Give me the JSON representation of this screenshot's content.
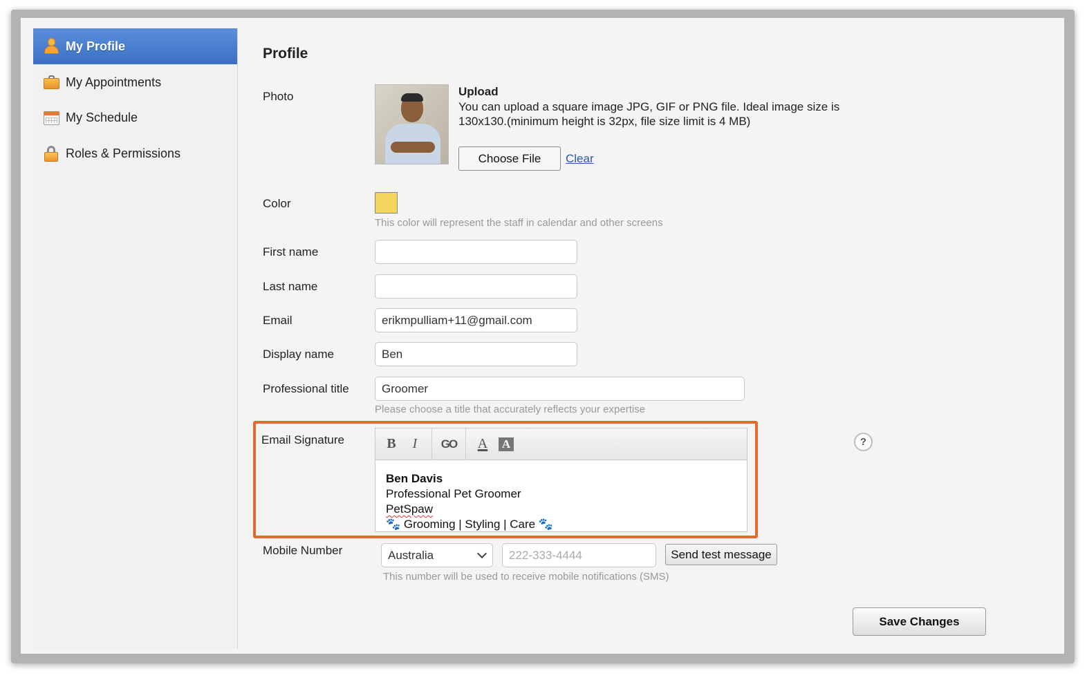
{
  "colors": {
    "sidebar_active": "#4a7fd2",
    "staff_color": "#f6d55c",
    "highlight_border": "#e3692f",
    "link": "#2a55b5"
  },
  "sidebar": {
    "items": [
      {
        "label": "My Profile",
        "icon": "user-icon",
        "active": true
      },
      {
        "label": "My Appointments",
        "icon": "briefcase-icon",
        "active": false
      },
      {
        "label": "My Schedule",
        "icon": "calendar-icon",
        "active": false
      },
      {
        "label": "Roles & Permissions",
        "icon": "lock-icon",
        "active": false
      }
    ]
  },
  "main": {
    "title": "Profile",
    "photo": {
      "label": "Photo",
      "upload_title": "Upload",
      "upload_description": "You can upload a square image JPG, GIF or PNG file. Ideal image size is 130x130.(minimum height is 32px, file size limit is 4 MB)",
      "choose_file_label": "Choose File",
      "clear_label": "Clear"
    },
    "color": {
      "label": "Color",
      "hint": "This color will represent the staff in calendar and other screens"
    },
    "first_name": {
      "label": "First name",
      "value": ""
    },
    "last_name": {
      "label": "Last name",
      "value": ""
    },
    "email": {
      "label": "Email",
      "value": "erikmpulliam+11@gmail.com"
    },
    "display_name": {
      "label": "Display name",
      "value": "Ben"
    },
    "professional_title": {
      "label": "Professional title",
      "value": "Groomer",
      "hint": "Please choose a title that accurately reflects your expertise"
    },
    "email_signature": {
      "label": "Email Signature",
      "toolbar": {
        "bold": "B",
        "italic": "I",
        "link": "GO",
        "font_color": "A",
        "bg_color": "A"
      },
      "lines": {
        "name": "Ben Davis",
        "title": "Professional Pet Groomer",
        "company": "PetSpaw",
        "tagline": "🐾 Grooming | Styling | Care 🐾"
      },
      "help": "?"
    },
    "mobile": {
      "label": "Mobile Number",
      "country": "Australia",
      "placeholder": "222-333-4444",
      "send_test_label": "Send test message",
      "hint": "This number will be used to receive mobile notifications (SMS)"
    },
    "save_label": "Save Changes"
  }
}
